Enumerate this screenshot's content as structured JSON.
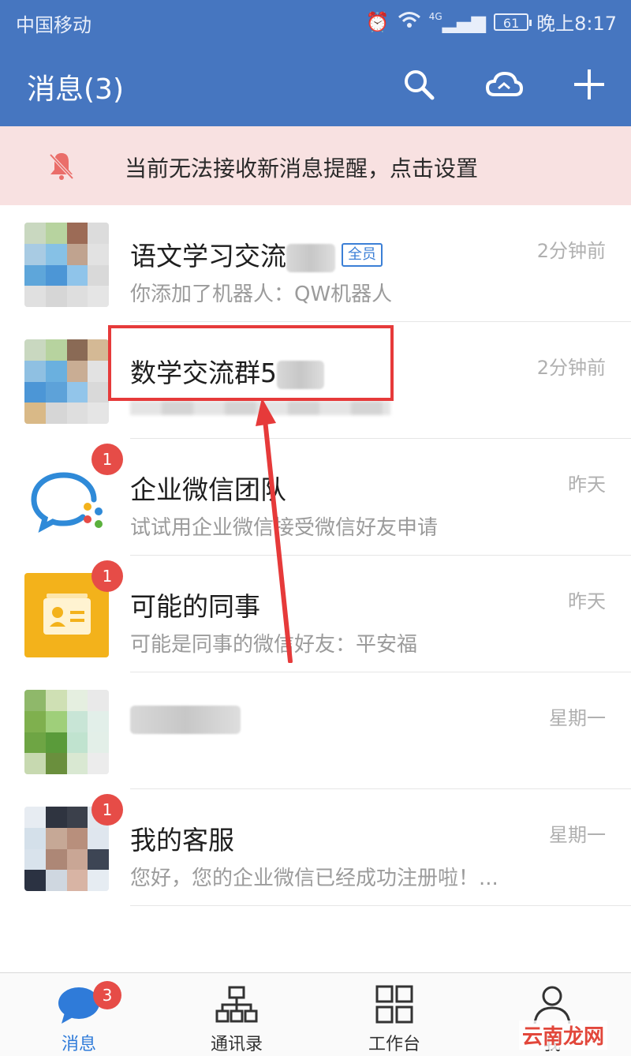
{
  "status_bar": {
    "carrier": "中国移动",
    "signal_label": "4G",
    "battery": "61",
    "time": "晚上8:17"
  },
  "header": {
    "title": "消息(3)",
    "search_icon": "search-icon",
    "cloud_icon": "cloud-icon",
    "add_icon": "plus-icon"
  },
  "banner": {
    "icon": "bell-muted-icon",
    "text": "当前无法接收新消息提醒，点击设置"
  },
  "conversations": [
    {
      "name": "语文学习交流",
      "tag": "全员",
      "preview": "你添加了机器人：QW机器人",
      "time": "2分钟前",
      "badge": ""
    },
    {
      "name": "数学交流群5",
      "tag": "",
      "preview": "",
      "time": "2分钟前",
      "badge": ""
    },
    {
      "name": "企业微信团队",
      "tag": "",
      "preview": "试试用企业微信接受微信好友申请",
      "time": "昨天",
      "badge": "1"
    },
    {
      "name": "可能的同事",
      "tag": "",
      "preview": "可能是同事的微信好友：平安福",
      "time": "昨天",
      "badge": "1"
    },
    {
      "name": "",
      "tag": "",
      "preview": "",
      "time": "星期一",
      "badge": ""
    },
    {
      "name": "我的客服",
      "tag": "",
      "preview": "您好，您的企业微信已经成功注册啦！...",
      "time": "星期一",
      "badge": "1"
    }
  ],
  "bottom_nav": [
    {
      "label": "消息",
      "icon": "chat-bubble-icon",
      "badge": "3",
      "active": true
    },
    {
      "label": "通讯录",
      "icon": "org-chart-icon",
      "badge": "",
      "active": false
    },
    {
      "label": "工作台",
      "icon": "grid-icon",
      "badge": "",
      "active": false
    },
    {
      "label": "我",
      "icon": "person-icon",
      "badge": "",
      "active": false
    }
  ],
  "watermark": "云南龙网",
  "colors": {
    "header_bg": "#4676c0",
    "banner_bg": "#f8e1e1",
    "badge": "#e64c47",
    "active_tab": "#2f7bd9",
    "annotation": "#e63a3a"
  }
}
